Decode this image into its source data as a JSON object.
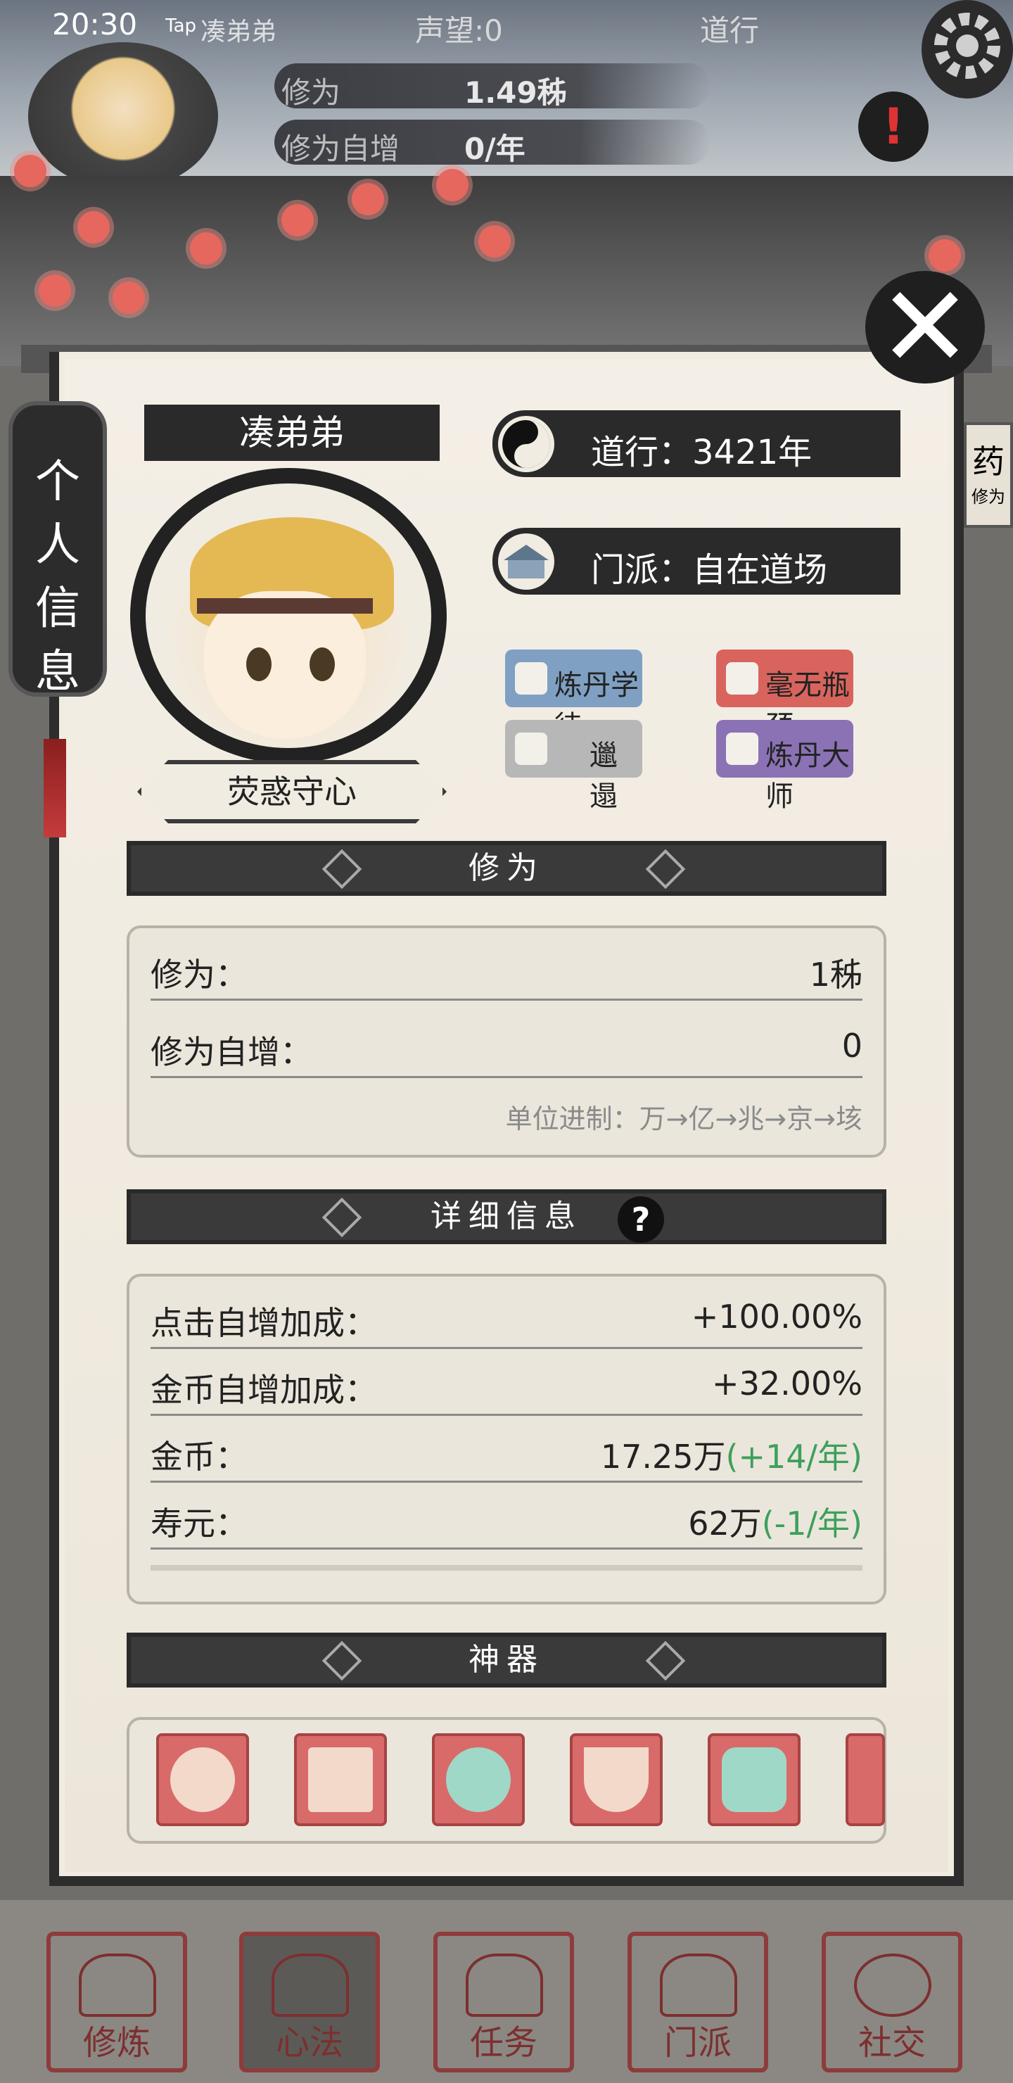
{
  "status_bar": {
    "time": "20:30",
    "reputation": "声望:0",
    "daoxing_top": "道行",
    "tap_label": "Tap",
    "username_small": "凑弟弟"
  },
  "top_stats": {
    "cultivation_label": "修为",
    "cultivation_value": "1.49秭",
    "increase_label": "修为自增",
    "increase_value": "0/年"
  },
  "side_tab": {
    "label": "个人信息"
  },
  "profile": {
    "name": "凑弟弟",
    "title": "荧惑守心",
    "daoxing": "道行：3421年",
    "sect": "门派：自在道场"
  },
  "tags": [
    {
      "label": "炼丹学徒",
      "color": "#6f8fb3"
    },
    {
      "label": "毫无瓶颈",
      "color": "#d9645e"
    },
    {
      "label": "邋遢",
      "color": "#b7b7b7"
    },
    {
      "label": "炼丹大师",
      "color": "#7e66a8"
    }
  ],
  "sections": {
    "cultivation_title": "修为",
    "detail_title": "详细信息",
    "artifact_title": "神器"
  },
  "cultivation_rows": [
    {
      "label": "修为：",
      "value": "1秭"
    },
    {
      "label": "修为自增：",
      "value": "0"
    }
  ],
  "unit_note": "单位进制：万→亿→兆→京→垓",
  "detail_rows": [
    {
      "label": "点击自增加成：",
      "value": "+100.00%",
      "extra": ""
    },
    {
      "label": "金币自增加成：",
      "value": "+32.00%",
      "extra": ""
    },
    {
      "label": "金币：",
      "value": "17.25万",
      "extra": "(+14/年)"
    },
    {
      "label": "寿元：",
      "value": "62万",
      "extra": "(-1/年)"
    }
  ],
  "bottom_nav": [
    {
      "label": "修炼"
    },
    {
      "label": "心法"
    },
    {
      "label": "任务"
    },
    {
      "label": "门派"
    },
    {
      "label": "社交"
    }
  ],
  "side_label_right": "药",
  "side_label_right_sub": "修为",
  "icons": {
    "settings": "gear-icon",
    "close": "close-icon",
    "alert": "exclamation-icon",
    "help": "question-icon"
  }
}
